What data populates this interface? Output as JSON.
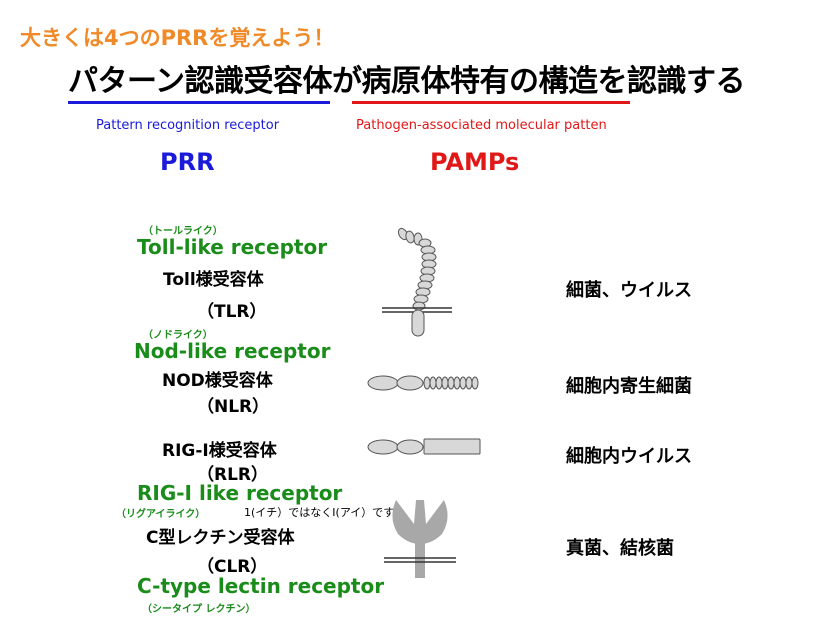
{
  "heading": "大きくは4つのPRRを覚えよう！",
  "title": "パターン認識受容体が病原体特有の構造を認識する",
  "subtitles": {
    "prr_full": "Pattern recognition receptor",
    "pamps_full": "Pathogen-associated molecular patten"
  },
  "columns": {
    "prr": "PRR",
    "pamps": "PAMPs"
  },
  "receptors": {
    "tlr": {
      "kana": "（トールライク）",
      "english": "Toll-like receptor",
      "japanese": "Toll様受容体",
      "abbr": "（TLR）",
      "pamps": "細菌、ウイルス"
    },
    "nlr": {
      "kana": "（ノドライク）",
      "english": "Nod-like receptor",
      "japanese": "NOD様受容体",
      "abbr": "（NLR）",
      "pamps": "細胞内寄生細菌"
    },
    "rlr": {
      "japanese": "RIG-I様受容体",
      "abbr": "（RLR）",
      "english": "RIG-I like receptor",
      "kana": "（リグアイライク）",
      "note": "1(イチ）ではなくI(アイ）です。",
      "pamps": "細胞内ウイルス"
    },
    "clr": {
      "japanese": "C型レクチン受容体",
      "abbr": "（CLR）",
      "english": "C-type lectin receptor",
      "kana": "（シータイプ レクチン）",
      "pamps": "真菌、結核菌"
    }
  },
  "colors": {
    "heading": "#f08a28",
    "prr": "#1a1ad8",
    "pamps": "#e01818",
    "receptor_name": "#1a8c1a",
    "shape_fill": "#d8d8d8",
    "clr_fill": "#a8a8a8"
  }
}
